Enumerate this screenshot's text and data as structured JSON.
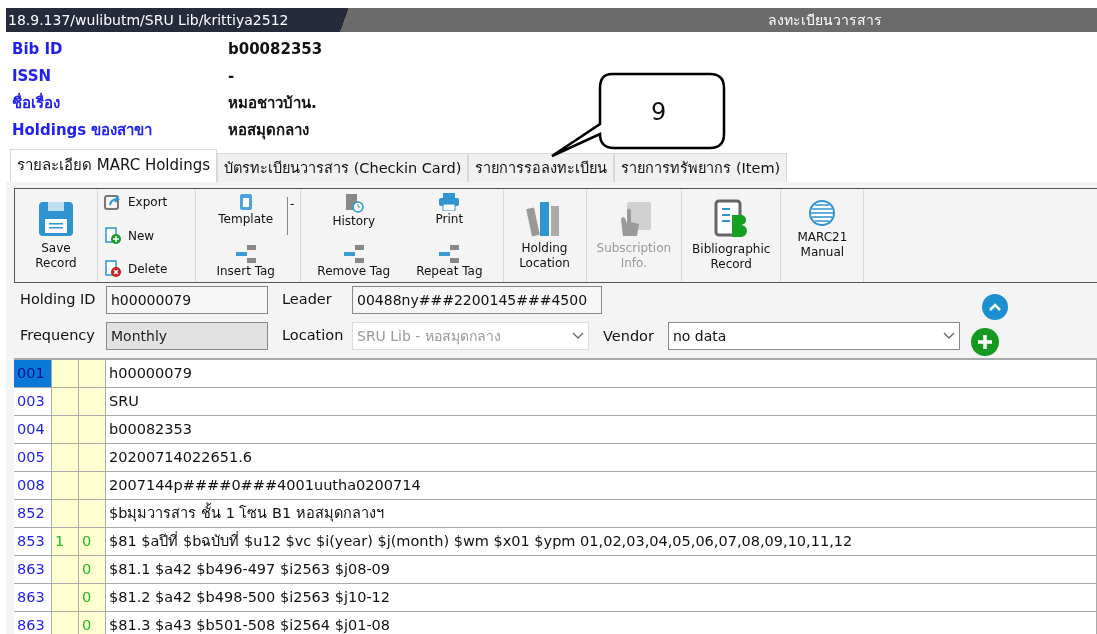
{
  "window": {
    "path": "18.9.137/wulibutm/SRU Lib/krittiya2512",
    "title": "ลงทะเบียนวารสาร"
  },
  "record": [
    {
      "label": "Bib ID",
      "value": "b00082353"
    },
    {
      "label": "ISSN",
      "value": "-"
    },
    {
      "label": "ชื่อเรื่อง",
      "value": "หมอชาวบ้าน."
    },
    {
      "label": "Holdings ของสาขา",
      "value": "หอสมุดกลาง"
    }
  ],
  "callout": {
    "text": "9"
  },
  "tabs": [
    {
      "label": "รายละเอียด MARC Holdings",
      "selected": true
    },
    {
      "label": "บัตรทะเบียนวารสาร (Checkin Card)",
      "selected": false
    },
    {
      "label": "รายการรอลงทะเบียน",
      "selected": false
    },
    {
      "label": "รายการทรัพยากร (Item)",
      "selected": false
    }
  ],
  "toolbar": {
    "save": {
      "label": "Save Record",
      "disabled": false
    },
    "export": {
      "label": "Export",
      "disabled": false
    },
    "new": {
      "label": "New",
      "disabled": false
    },
    "delete": {
      "label": "Delete",
      "disabled": false
    },
    "template": {
      "label": "Template",
      "disabled": false
    },
    "insert_tag": {
      "label": "Insert Tag",
      "disabled": false
    },
    "template_dropdown": "-",
    "history": {
      "label": "History",
      "disabled": false
    },
    "remove_tag": {
      "label": "Remove Tag",
      "disabled": false
    },
    "print": {
      "label": "Print",
      "disabled": false
    },
    "repeat_tag": {
      "label": "Repeat Tag",
      "disabled": false
    },
    "holding_location": {
      "label": "Holding Location",
      "disabled": false
    },
    "subscription": {
      "label": "Subscription Info.",
      "disabled": true
    },
    "bibliographic": {
      "label": "Bibliographic Record",
      "disabled": false
    },
    "marc21": {
      "label": "MARC21 Manual",
      "disabled": false
    }
  },
  "form": {
    "holding_id": {
      "label": "Holding ID",
      "value": "h00000079"
    },
    "leader": {
      "label": "Leader",
      "value": "00488ny###2200145###4500"
    },
    "frequency": {
      "label": "Frequency",
      "value": "Monthly",
      "disabled": true
    },
    "location": {
      "label": "Location",
      "value": "SRU Lib - หอสมุดกลาง",
      "disabled": true
    },
    "vendor": {
      "label": "Vendor",
      "value": "no data",
      "disabled": false
    }
  },
  "marc_rows": [
    {
      "tag": "001",
      "ind1": "",
      "ind2": "",
      "data": "h00000079",
      "selected": true
    },
    {
      "tag": "003",
      "ind1": "",
      "ind2": "",
      "data": "SRU",
      "selected": false
    },
    {
      "tag": "004",
      "ind1": "",
      "ind2": "",
      "data": "b00082353",
      "selected": false
    },
    {
      "tag": "005",
      "ind1": "",
      "ind2": "",
      "data": "20200714022651.6",
      "selected": false
    },
    {
      "tag": "008",
      "ind1": "",
      "ind2": "",
      "data": "2007144p####0###4001uutha0200714",
      "selected": false
    },
    {
      "tag": "852",
      "ind1": "",
      "ind2": "",
      "data": "$bมุมวารสาร ชั้น 1 โซน B1 หอสมุดกลางฯ",
      "selected": false
    },
    {
      "tag": "853",
      "ind1": "1",
      "ind2": "0",
      "data": "$81 $aปีที่ $bฉบับที่ $u12 $vc $i(year) $j(month) $wm $x01 $ypm 01,02,03,04,05,06,07,08,09,10,11,12",
      "selected": false
    },
    {
      "tag": "863",
      "ind1": "",
      "ind2": "0",
      "data": "$81.1  $a42  $b496-497  $i2563  $j08-09",
      "selected": false
    },
    {
      "tag": "863",
      "ind1": "",
      "ind2": "0",
      "data": "$81.2  $a42  $b498-500  $i2563  $j10-12",
      "selected": false
    },
    {
      "tag": "863",
      "ind1": "",
      "ind2": "0",
      "data": "$81.3  $a43  $b501-508  $i2564  $j01-08",
      "selected": false
    }
  ]
}
